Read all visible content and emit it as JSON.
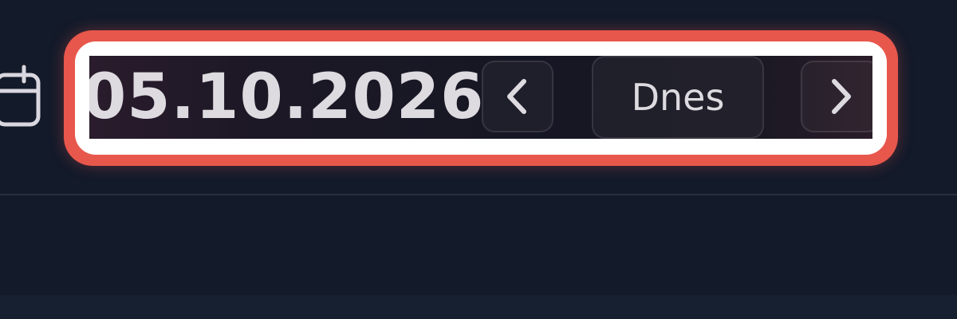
{
  "date_picker": {
    "current_date": "05.10.2026",
    "today_label": "Dnes",
    "icons": {
      "calendar": "calendar-icon",
      "prev": "chevron-left-icon",
      "next": "chevron-right-icon"
    }
  },
  "colors": {
    "background": "#131a2a",
    "highlight": "#e8574c",
    "text": "#dedbe0"
  }
}
